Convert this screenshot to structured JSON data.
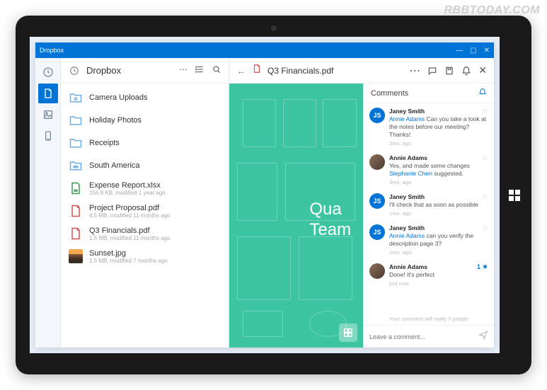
{
  "watermark": "RBBTODAY.COM",
  "window": {
    "title": "Dropbox"
  },
  "sidebar": {
    "items": [
      {
        "name": "recent",
        "active": false
      },
      {
        "name": "files",
        "active": true
      },
      {
        "name": "photos",
        "active": false
      },
      {
        "name": "offline",
        "active": false
      }
    ]
  },
  "filePane": {
    "title": "Dropbox",
    "items": [
      {
        "type": "folder-photos",
        "name": "Camera Uploads",
        "meta": ""
      },
      {
        "type": "folder",
        "name": "Holiday Photos",
        "meta": ""
      },
      {
        "type": "folder",
        "name": "Receipts",
        "meta": ""
      },
      {
        "type": "folder-shared",
        "name": "South America",
        "meta": ""
      },
      {
        "type": "xlsx",
        "name": "Expense Report.xlsx",
        "meta": "156.8 KB, modified 1 year ago"
      },
      {
        "type": "pdf",
        "name": "Project Proposal.pdf",
        "meta": "4.5 MB, modified 11 months ago"
      },
      {
        "type": "pdf",
        "name": "Q3 Financials.pdf",
        "meta": "1.5 MB, modified 11 months ago"
      },
      {
        "type": "image",
        "name": "Sunset.jpg",
        "meta": "1.5 MB, modified 7 months ago"
      }
    ]
  },
  "preview": {
    "title": "Q3 Financials.pdf",
    "overlayLine1": "Qua",
    "overlayLine2": "Team"
  },
  "comments": {
    "header": "Comments",
    "hint": "Your comment will notify 3 people",
    "placeholder": "Leave a comment...",
    "items": [
      {
        "author": "Janey Smith",
        "initials": "JS",
        "avatar": "initials",
        "mention": "Annie Adams",
        "text": " Can you take a look at the notes before our meeting? Thanks!",
        "time": "3mo. ago",
        "starred": false
      },
      {
        "author": "Annie Adams",
        "avatar": "photo",
        "textPrefix": "Yes, and made some changes ",
        "mention": "Stephanie Chen",
        "text": " suggested.",
        "time": "3mo. ago",
        "starred": false
      },
      {
        "author": "Janey Smith",
        "initials": "JS",
        "avatar": "initials",
        "text": "I'll check that as soon as possible",
        "time": "1mo. ago",
        "starred": false
      },
      {
        "author": "Janey Smith",
        "initials": "JS",
        "avatar": "initials",
        "mention": "Annie Adams",
        "text": " can you verify the description page 3?",
        "time": "1mo. ago",
        "starred": false
      },
      {
        "author": "Annie Adams",
        "avatar": "photo",
        "text": "Done! It's perfect",
        "time": "just now",
        "starred": true,
        "starCount": "1"
      }
    ]
  }
}
